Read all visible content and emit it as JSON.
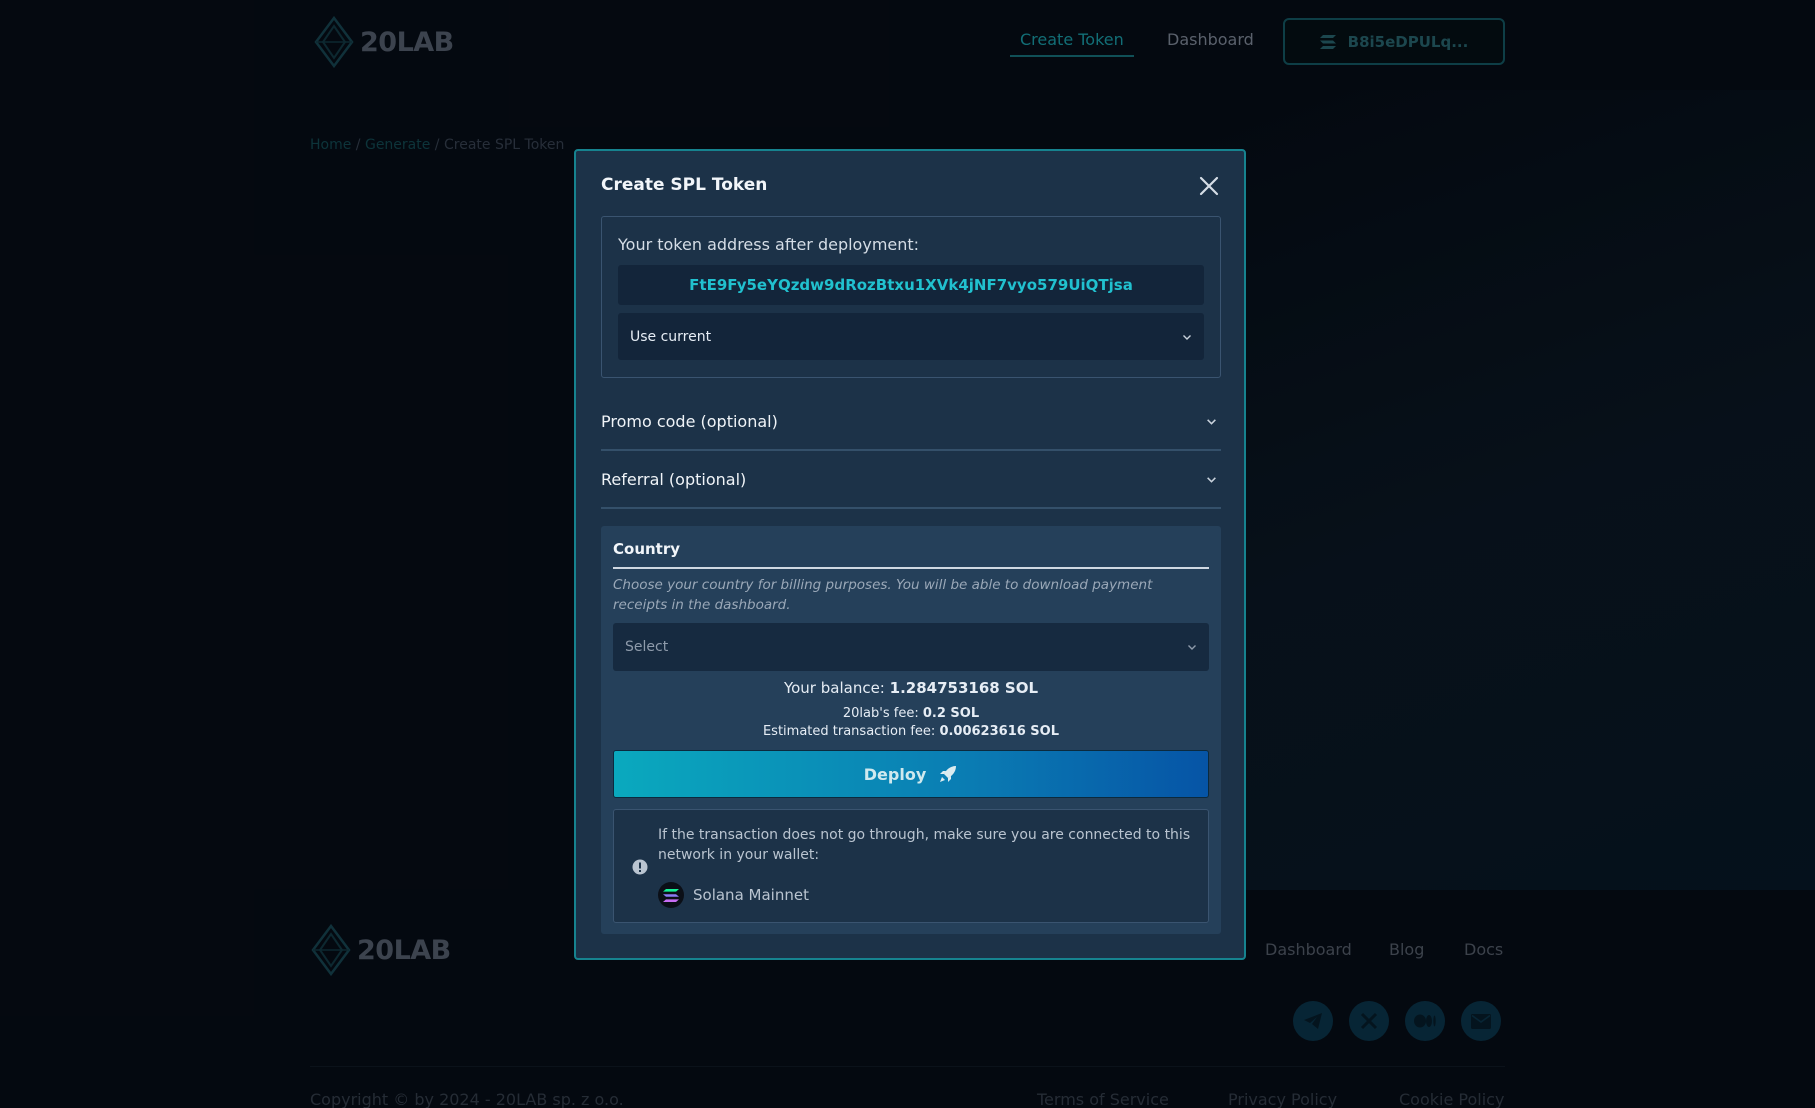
{
  "brand": {
    "name": "20LAB"
  },
  "header": {
    "nav": [
      {
        "label": "Create Token",
        "active": true
      },
      {
        "label": "Dashboard",
        "active": false
      }
    ],
    "wallet_label": "B8i5eDPULq..."
  },
  "breadcrumb": {
    "home": "Home",
    "sep1": " / ",
    "generate": "Generate",
    "sep2": " / ",
    "current": "Create SPL Token"
  },
  "modal": {
    "title": "Create SPL Token",
    "address": {
      "label": "Your token address after deployment:",
      "value": "FtE9Fy5eYQzdw9dRozBtxu1XVk4jNF7vyo579UiQTjsa",
      "mode_selected": "Use current"
    },
    "promo_label": "Promo code (optional)",
    "referral_label": "Referral (optional)",
    "country": {
      "title": "Country",
      "help": "Choose your country for billing purposes. You will be able to download payment receipts in the dashboard.",
      "placeholder": "Select"
    },
    "balance": {
      "label": "Your balance:",
      "value": "1.284753168 SOL"
    },
    "fee": {
      "label": "20lab's fee:",
      "value": "0.2 SOL"
    },
    "tx_fee": {
      "label": "Estimated transaction fee:",
      "value": "0.00623616 SOL"
    },
    "deploy_label": "Deploy",
    "notice": {
      "text": "If the transaction does not go through, make sure you are connected to this network in your wallet:",
      "network": "Solana Mainnet"
    }
  },
  "footer": {
    "links": [
      "Dashboard",
      "Blog",
      "Docs"
    ],
    "social": [
      "telegram-icon",
      "x-icon",
      "medium-icon",
      "mail-icon"
    ],
    "copyright": "Copyright © by 2024 - 20LAB sp. z o.o.",
    "legal": [
      "Terms of Service",
      "Privacy Policy",
      "Cookie Policy"
    ]
  },
  "colors": {
    "accent": "#1ca9b6",
    "modal_bg": "#1c3248",
    "modal_border": "#16838f",
    "page_bg": "#070e19"
  }
}
